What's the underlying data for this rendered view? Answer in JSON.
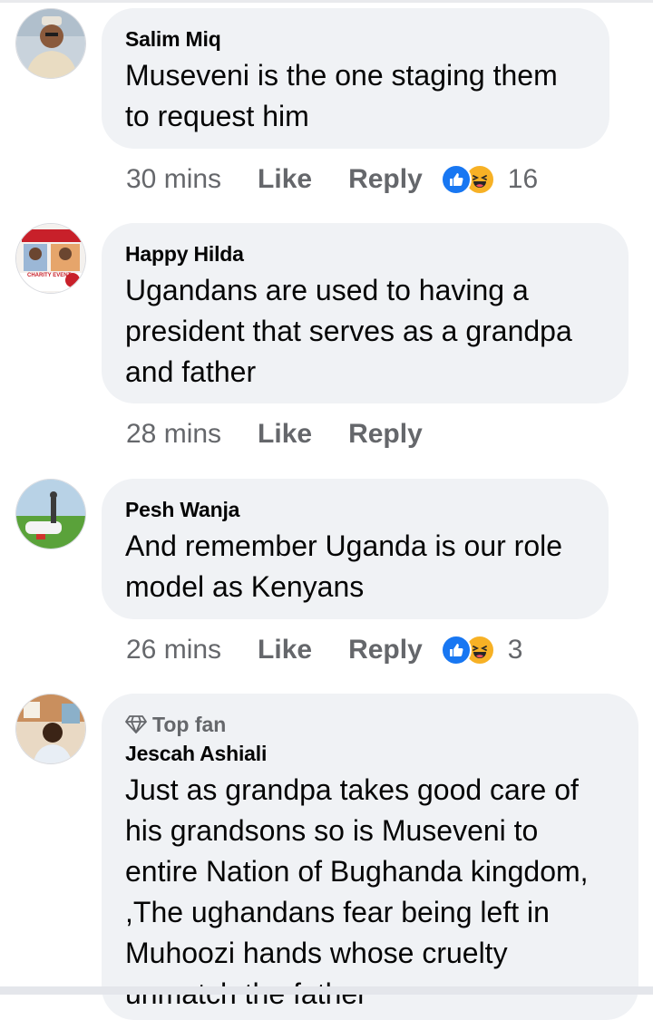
{
  "comments": [
    {
      "author": "Salim Miq",
      "text_lines": [
        "Museveni is the one staging them",
        "to request him"
      ],
      "time": "30 mins",
      "like_label": "Like",
      "reply_label": "Reply",
      "reactions": [
        "like-icon",
        "haha-icon"
      ],
      "reaction_count": "16"
    },
    {
      "author": "Happy Hilda",
      "text_lines": [
        "Ugandans are used to having a",
        "president that serves as a grandpa",
        "and father"
      ],
      "time": "28 mins",
      "like_label": "Like",
      "reply_label": "Reply",
      "avatar_caption": "CHARITY EVENT"
    },
    {
      "author": "Pesh Wanja",
      "text_lines": [
        "And remember Uganda is our role",
        "model as Kenyans"
      ],
      "time": "26 mins",
      "like_label": "Like",
      "reply_label": "Reply",
      "reactions": [
        "like-icon",
        "haha-icon"
      ],
      "reaction_count": "3"
    },
    {
      "badge": "Top fan",
      "author": "Jescah Ashiali",
      "text_lines": [
        "Just as grandpa takes good care of",
        "his grandsons so is Museveni to",
        "entire Nation of Bughanda kingdom,",
        ",The ughandans fear being left in",
        "Muhoozi hands whose cruelty",
        "unmatch the father"
      ]
    }
  ],
  "colors": {
    "bubble": "#f0f2f5",
    "secondary_text": "#65676b",
    "like_blue": "#1877f2",
    "haha_yellow": "#f7b125"
  }
}
